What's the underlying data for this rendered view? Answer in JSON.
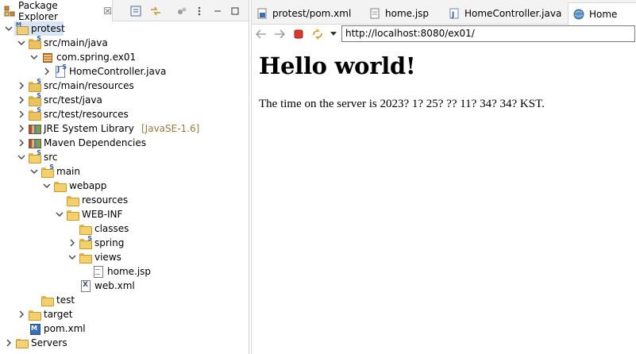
{
  "explorer": {
    "tab_label": "Package Explorer",
    "tab_close": "☒"
  },
  "tree": [
    {
      "label": "protest",
      "arrow": "∨",
      "icon": "project-icon",
      "selected": true
    },
    {
      "label": "src/main/java",
      "arrow": "∨",
      "icon": "source-folder-icon"
    },
    {
      "label": "com.spring.ex01",
      "arrow": "∨",
      "icon": "package-icon"
    },
    {
      "label": "HomeController.java",
      "arrow": ">",
      "icon": "java-file-icon"
    },
    {
      "label": "src/main/resources",
      "arrow": ">",
      "icon": "source-folder-icon"
    },
    {
      "label": "src/test/java",
      "arrow": ">",
      "icon": "source-folder-icon"
    },
    {
      "label": "src/test/resources",
      "arrow": ">",
      "icon": "source-folder-icon"
    },
    {
      "label": "JRE System Library",
      "decoration": "[JavaSE-1.6]",
      "arrow": ">",
      "icon": "library-icon"
    },
    {
      "label": "Maven Dependencies",
      "arrow": ">",
      "icon": "library-icon"
    },
    {
      "label": "src",
      "arrow": "∨",
      "icon": "folder-icon"
    },
    {
      "label": "main",
      "arrow": "∨",
      "icon": "folder-icon"
    },
    {
      "label": "webapp",
      "arrow": "∨",
      "icon": "folder-icon"
    },
    {
      "label": "resources",
      "arrow": "",
      "icon": "folder-icon"
    },
    {
      "label": "WEB-INF",
      "arrow": "∨",
      "icon": "folder-icon"
    },
    {
      "label": "classes",
      "arrow": "",
      "icon": "folder-icon"
    },
    {
      "label": "spring",
      "arrow": ">",
      "icon": "folder-icon"
    },
    {
      "label": "views",
      "arrow": "∨",
      "icon": "folder-icon"
    },
    {
      "label": "home.jsp",
      "arrow": "",
      "icon": "jsp-file-icon"
    },
    {
      "label": "web.xml",
      "arrow": "",
      "icon": "xml-file-icon"
    },
    {
      "label": "test",
      "arrow": "",
      "icon": "folder-icon"
    },
    {
      "label": "target",
      "arrow": ">",
      "icon": "folder-icon"
    },
    {
      "label": "pom.xml",
      "arrow": "",
      "icon": "pom-file-icon"
    },
    {
      "label": "Servers",
      "arrow": ">",
      "icon": "server-folder-icon"
    }
  ],
  "editor": {
    "tabs": [
      {
        "label": "protest/pom.xml",
        "icon": "pom-file-icon"
      },
      {
        "label": "home.jsp",
        "icon": "jsp-file-icon"
      },
      {
        "label": "HomeController.java",
        "icon": "java-file-icon"
      },
      {
        "label": "Home",
        "icon": "globe-icon",
        "active": true
      }
    ],
    "url": "http://localhost:8080/ex01/"
  },
  "page": {
    "heading": "Hello world!",
    "server_time": "The time on the server is 2023? 1? 25? ?? 11? 34? 34? KST."
  }
}
